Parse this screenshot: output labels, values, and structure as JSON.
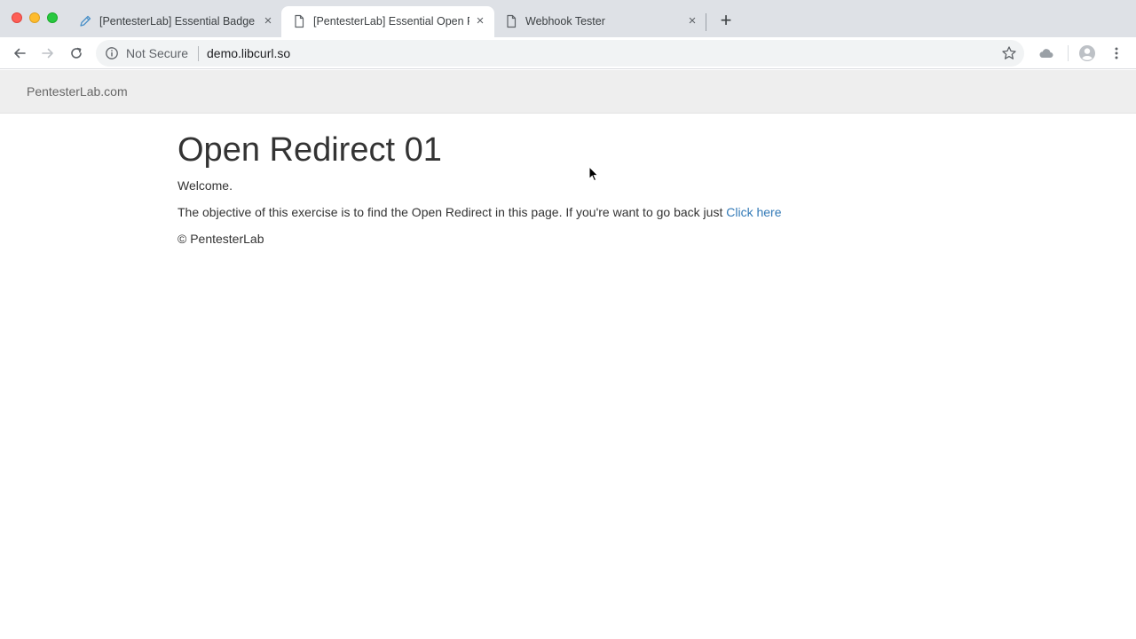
{
  "browser": {
    "tabs": [
      {
        "title": "[PentesterLab] Essential Badge",
        "favicon": "pencil-icon",
        "active": false
      },
      {
        "title": "[PentesterLab] Essential Open Redirect",
        "favicon": "document-icon",
        "active": true
      },
      {
        "title": "Webhook Tester",
        "favicon": "document-icon",
        "active": false
      }
    ],
    "new_tab_symbol": "+",
    "close_symbol": "×",
    "security_label": "Not Secure",
    "url": "demo.libcurl.so"
  },
  "page": {
    "brand": "PentesterLab.com",
    "heading": "Open Redirect 01",
    "welcome": "Welcome.",
    "objective_text": "The objective of this exercise is to find the Open Redirect in this page. If you're want to go back just ",
    "link_text": "Click here",
    "footer": "© PentesterLab"
  },
  "colors": {
    "tabstrip_bg": "#dee1e6",
    "navbar_bg": "#eeeeee",
    "link": "#337ab7",
    "text": "#333333"
  }
}
